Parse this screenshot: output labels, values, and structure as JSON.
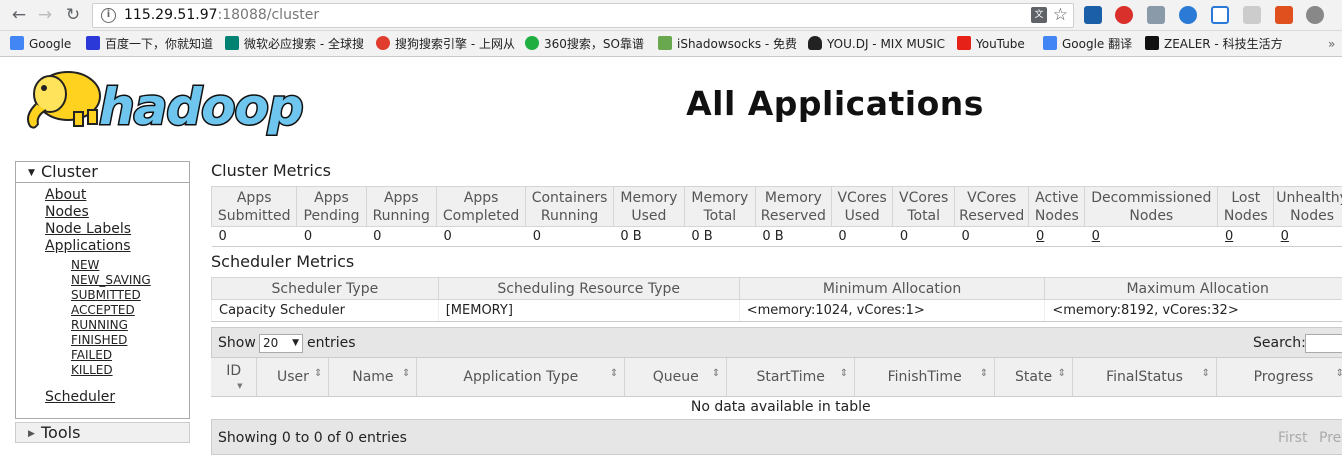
{
  "browser": {
    "url_host": "115.29.51.97",
    "url_rest": ":18088/cluster",
    "bookmarks": [
      {
        "label": "Google",
        "color": "#4285f4"
      },
      {
        "label": "百度一下，你就知道",
        "color": "#2b39d8"
      },
      {
        "label": "微软必应搜索 - 全球搜",
        "color": "#008373"
      },
      {
        "label": "搜狗搜索引擎 - 上网从",
        "color": "#e03d2e"
      },
      {
        "label": "360搜索，SO靠谱",
        "color": "#1fae3f"
      },
      {
        "label": "iShadowsocks - 免费",
        "color": "#6aa84f"
      },
      {
        "label": "YOU.DJ - MIX MUSIC",
        "color": "#222222"
      },
      {
        "label": "YouTube",
        "color": "#e62117"
      },
      {
        "label": "Google 翻译",
        "color": "#4285f4"
      },
      {
        "label": "ZEALER - 科技生活方",
        "color": "#111111"
      }
    ]
  },
  "header": {
    "title": "All Applications",
    "logo_text": "hadoop"
  },
  "nav": {
    "cluster_label": "Cluster",
    "cluster_links": [
      "About",
      "Nodes",
      "Node Labels",
      "Applications"
    ],
    "app_states": [
      "NEW",
      "NEW_SAVING",
      "SUBMITTED",
      "ACCEPTED",
      "RUNNING",
      "FINISHED",
      "FAILED",
      "KILLED"
    ],
    "scheduler": "Scheduler",
    "tools_label": "Tools"
  },
  "cluster_metrics": {
    "title": "Cluster Metrics",
    "columns": [
      "Apps Submitted",
      "Apps Pending",
      "Apps Running",
      "Apps Completed",
      "Containers Running",
      "Memory Used",
      "Memory Total",
      "Memory Reserved",
      "VCores Used",
      "VCores Total",
      "VCores Reserved",
      "Active Nodes",
      "Decommissioned Nodes",
      "Lost Nodes",
      "Unhealthy Nodes"
    ],
    "values": [
      "0",
      "0",
      "0",
      "0",
      "0",
      "0 B",
      "0 B",
      "0 B",
      "0",
      "0",
      "0",
      "0",
      "0",
      "0",
      "0"
    ]
  },
  "scheduler_metrics": {
    "title": "Scheduler Metrics",
    "columns": [
      "Scheduler Type",
      "Scheduling Resource Type",
      "Minimum Allocation",
      "Maximum Allocation"
    ],
    "values": [
      "Capacity Scheduler",
      "[MEMORY]",
      "<memory:1024, vCores:1>",
      "<memory:8192, vCores:32>"
    ]
  },
  "apps_table": {
    "show_label": "Show",
    "page_size": "20",
    "entries_label": "entries",
    "search_label": "Search:",
    "columns": [
      "ID",
      "User",
      "Name",
      "Application Type",
      "Queue",
      "StartTime",
      "FinishTime",
      "State",
      "FinalStatus",
      "Progress"
    ],
    "empty_message": "No data available in table",
    "info": "Showing 0 to 0 of 0 entries",
    "first": "First",
    "previous": "Previous"
  }
}
